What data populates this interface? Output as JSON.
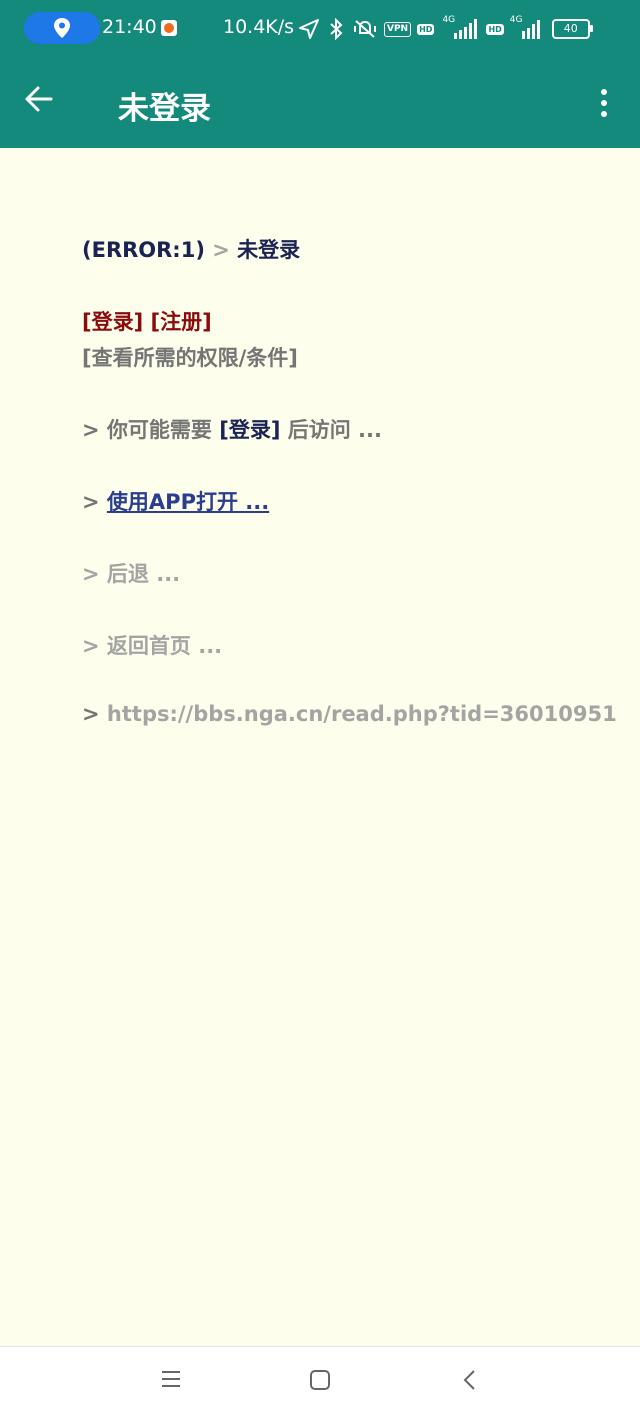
{
  "status_bar": {
    "time": "21:40",
    "net_speed": "10.4K/s",
    "vpn_label": "VPN",
    "hd1_label": "HD",
    "sig1_label": "4G",
    "hd2_label": "HD",
    "sig2_label": "4G",
    "battery": "40",
    "icons": [
      "location-icon",
      "notification-icon",
      "navigation-arrow-icon",
      "bluetooth-icon",
      "mute-vibrate-icon",
      "vpn-icon",
      "hd-icon",
      "signal-icon",
      "battery-icon"
    ]
  },
  "app_bar": {
    "title": "未登录",
    "back_icon": "arrow-left-icon",
    "menu_icon": "more-vert-icon",
    "color": "#138a7b"
  },
  "content": {
    "error_code": "(ERROR:1)",
    "sep": ">",
    "error_title": "未登录",
    "login_link": "[登录]",
    "register_link": "[注册]",
    "permissions_link": "[查看所需的权限/条件]",
    "need_prefix": "> 你可能需要",
    "need_login_link": "[登录]",
    "need_suffix": "后访问 ...",
    "open_app_prefix": ">",
    "open_app_link": "使用APP打开 ...",
    "go_back": "> 后退 ...",
    "home": "> 返回首页 ...",
    "url_prefix": ">",
    "url": "https://bbs.nga.cn/read.php?tid=36010951"
  },
  "nav_bar": {
    "icons": [
      "menu-icon",
      "home-square-icon",
      "back-chevron-icon"
    ]
  },
  "colors": {
    "background": "#fefeec",
    "navy": "#1a2353",
    "red": "#8b0b0b",
    "gray": "#757575",
    "link": "#2a3d8f"
  }
}
